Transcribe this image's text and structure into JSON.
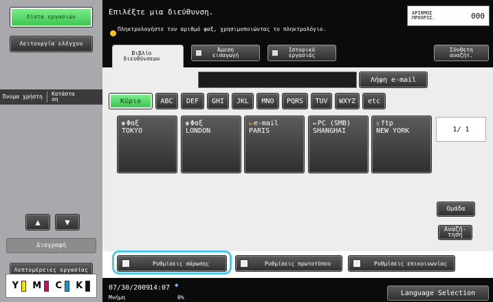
{
  "left_panel": {
    "job_list_label": "Λίστα εργασιών",
    "check_job_label": "Λειτουργία ελέγχου",
    "user_header": {
      "name_label": "Όνομα χρήστη",
      "status_label": "Κατάστα ση"
    },
    "up_arrow": "▲",
    "down_arrow": "▼",
    "delete_label": "Διαγραφή",
    "job_details_label": "Λεπτομέρειες εργασίας",
    "toner": [
      {
        "letter": "Y",
        "color": "#f2e600"
      },
      {
        "letter": "M",
        "color": "#e0006e"
      },
      {
        "letter": "C",
        "color": "#00a0e0"
      },
      {
        "letter": "K",
        "color": "#111111"
      }
    ]
  },
  "header": {
    "title": "Επιλέξτε μια διεύθυνση.",
    "hint": "Πληκτρολογήστε τον αριθμό φαξ, χρησιμοποιώντας το πληκτρολόγιο.",
    "copies_label": "ΑΡΙΘΜΟΣ ΠΡΟΟΡΙΣ.",
    "copies_value": "000"
  },
  "tabs": {
    "address_book": "Βιβλίο διευθύνσεων",
    "direct_input": "Άμεση εισαγωγή",
    "job_history": "Ιστορικό εργασιάς",
    "advanced_search": "Σύνθετη αναζήτ."
  },
  "main": {
    "email_button": "Λήψη e-mail",
    "index_keys": [
      "Κύριο",
      "ABC",
      "DEF",
      "GHI",
      "JKL",
      "MNO",
      "PQRS",
      "TUV",
      "WXYZ",
      "etc"
    ],
    "destinations": [
      {
        "type": "Φαξ",
        "name": "TOKYO",
        "icon": "fax-icon"
      },
      {
        "type": "Φαξ",
        "name": "LONDON",
        "icon": "fax-icon"
      },
      {
        "type": "e-mail",
        "name": "PARIS",
        "icon": "email-icon"
      },
      {
        "type": "PC (SMB)",
        "name": "SHANGHAI",
        "icon": "pc-icon"
      },
      {
        "type": "ftp",
        "name": "NEW YORK",
        "icon": "ftp-icon"
      }
    ],
    "page_indicator": "1/  1",
    "group_button": "Ομάδα",
    "search_button": "Αναζή-τηση"
  },
  "settings_bar": {
    "scan_settings": "Ρυθμίσεις σάρωσης",
    "original_settings": "Ρυθμίσεις πρωτοτύπου",
    "comm_settings": "Ρυθμίσεις επικοινωνίας"
  },
  "footer": {
    "date": "07/30/2009",
    "time": "14:07",
    "memory_label": "Μνήμη",
    "memory_value": "0%",
    "language_button": "Language Selection"
  }
}
